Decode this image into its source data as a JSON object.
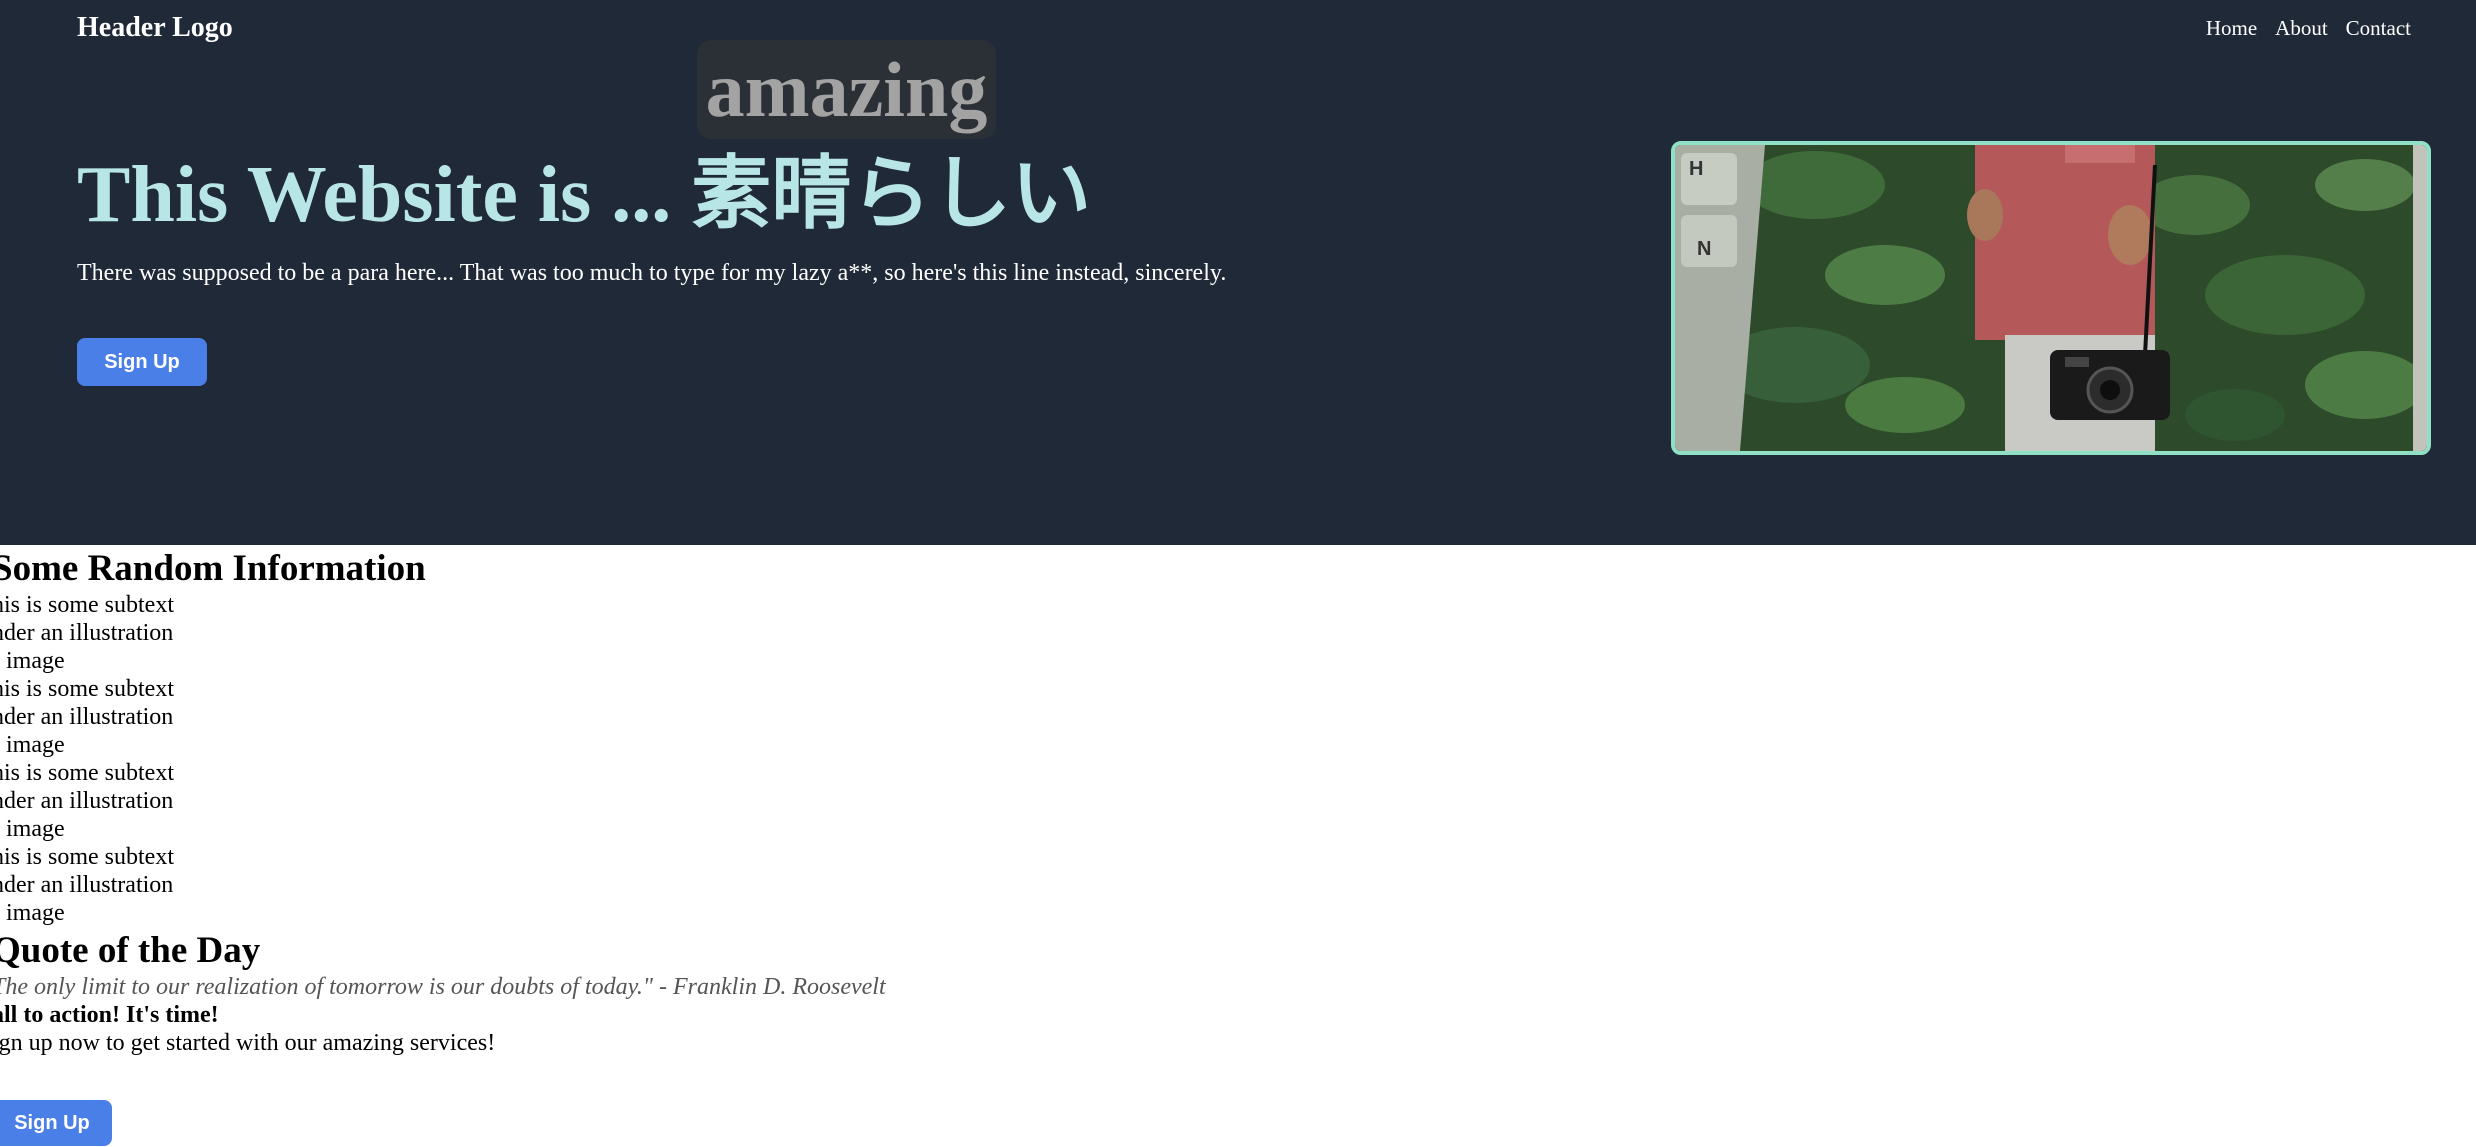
{
  "header": {
    "logo": "Header Logo",
    "nav": [
      "Home",
      "About",
      "Contact"
    ]
  },
  "hero": {
    "floating_word": "amazing",
    "title_en": "This Website is ... ",
    "title_jp": "素晴らしい",
    "text": "There was supposed to be a para here... That was too much to type for my lazy a**, so here's this line instead, sincerely.",
    "button": "Sign Up",
    "image_icon": "photo-keyboard-camera-leaves"
  },
  "info": {
    "heading": "Some Random Information",
    "items": [
      [
        "his is some subtext",
        "nder an illustration",
        "r image"
      ],
      [
        "his is some subtext",
        "nder an illustration",
        "r image"
      ],
      [
        "his is some subtext",
        "nder an illustration",
        "r image"
      ],
      [
        "his is some subtext",
        "nder an illustration",
        "r image"
      ]
    ]
  },
  "quote": {
    "heading": "Quote of the Day",
    "text": "The only limit to our realization of tomorrow is our doubts of today.\" - Franklin D. Roosevelt"
  },
  "cta": {
    "title": "all to action! It's time!",
    "text": "ign up now to get started with our amazing services!",
    "button": "Sign Up"
  },
  "colors": {
    "hero_bg": "#1f2937",
    "accent_title": "#b8e6e6",
    "button": "#4b7fe8",
    "image_border": "#8fe0c4"
  }
}
